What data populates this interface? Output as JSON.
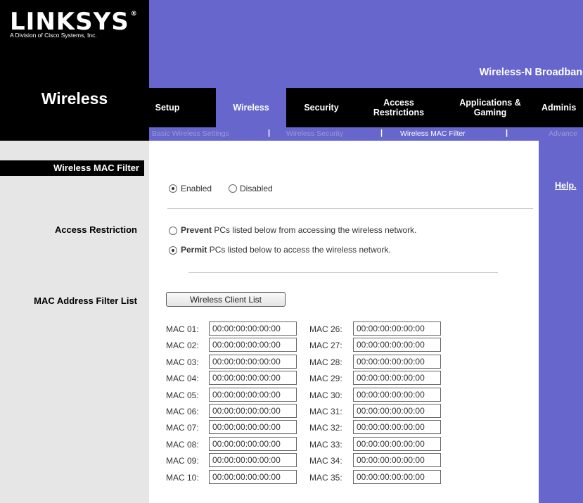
{
  "brand": {
    "name": "LINKSYS",
    "registered": "®",
    "tagline": "A Division of Cisco Systems, Inc."
  },
  "product_title": "Wireless-N Broadband",
  "section": "Wireless",
  "tabs": [
    {
      "label": "Setup",
      "active": false
    },
    {
      "label": "Wireless",
      "active": true
    },
    {
      "label": "Security",
      "active": false
    },
    {
      "label": "Access Restrictions",
      "active": false
    },
    {
      "label": "Applications & Gaming",
      "active": false
    },
    {
      "label": "Adminis",
      "active": false
    }
  ],
  "subnav": [
    {
      "label": "Basic Wireless Settings",
      "active": false
    },
    {
      "label": "Wireless Security",
      "active": false
    },
    {
      "label": "Wireless MAC Filter",
      "active": true
    },
    {
      "label": "Advance",
      "active": false
    }
  ],
  "subnav_separator": "|",
  "left_labels": {
    "title": "Wireless MAC Filter",
    "access_restriction": "Access Restriction",
    "mac_list": "MAC Address Filter List"
  },
  "filter": {
    "enabled_label": "Enabled",
    "disabled_label": "Disabled",
    "selected": "Enabled"
  },
  "access": {
    "prevent_bold": "Prevent",
    "prevent_rest": "PCs listed below from accessing the wireless network.",
    "permit_bold": "Permit",
    "permit_rest": "PCs listed below to access the wireless network.",
    "selected": "Permit"
  },
  "wireless_client_list_button": "Wireless Client List",
  "help_link": "Help.",
  "mac_left": [
    {
      "label": "MAC 01:",
      "value": "00:00:00:00:00:00"
    },
    {
      "label": "MAC 02:",
      "value": "00:00:00:00:00:00"
    },
    {
      "label": "MAC 03:",
      "value": "00:00:00:00:00:00"
    },
    {
      "label": "MAC 04:",
      "value": "00:00:00:00:00:00"
    },
    {
      "label": "MAC 05:",
      "value": "00:00:00:00:00:00"
    },
    {
      "label": "MAC 06:",
      "value": "00:00:00:00:00:00"
    },
    {
      "label": "MAC 07:",
      "value": "00:00:00:00:00:00"
    },
    {
      "label": "MAC 08:",
      "value": "00:00:00:00:00:00"
    },
    {
      "label": "MAC 09:",
      "value": "00:00:00:00:00:00"
    },
    {
      "label": "MAC 10:",
      "value": "00:00:00:00:00:00"
    }
  ],
  "mac_right": [
    {
      "label": "MAC 26:",
      "value": "00:00:00:00:00:00"
    },
    {
      "label": "MAC 27:",
      "value": "00:00:00:00:00:00"
    },
    {
      "label": "MAC 28:",
      "value": "00:00:00:00:00:00"
    },
    {
      "label": "MAC 29:",
      "value": "00:00:00:00:00:00"
    },
    {
      "label": "MAC 30:",
      "value": "00:00:00:00:00:00"
    },
    {
      "label": "MAC 31:",
      "value": "00:00:00:00:00:00"
    },
    {
      "label": "MAC 32:",
      "value": "00:00:00:00:00:00"
    },
    {
      "label": "MAC 33:",
      "value": "00:00:00:00:00:00"
    },
    {
      "label": "MAC 34:",
      "value": "00:00:00:00:00:00"
    },
    {
      "label": "MAC 35:",
      "value": "00:00:00:00:00:00"
    }
  ],
  "colors": {
    "brand_purple": "#6666cc",
    "black": "#000000",
    "left_gray": "#e6e6e6"
  }
}
